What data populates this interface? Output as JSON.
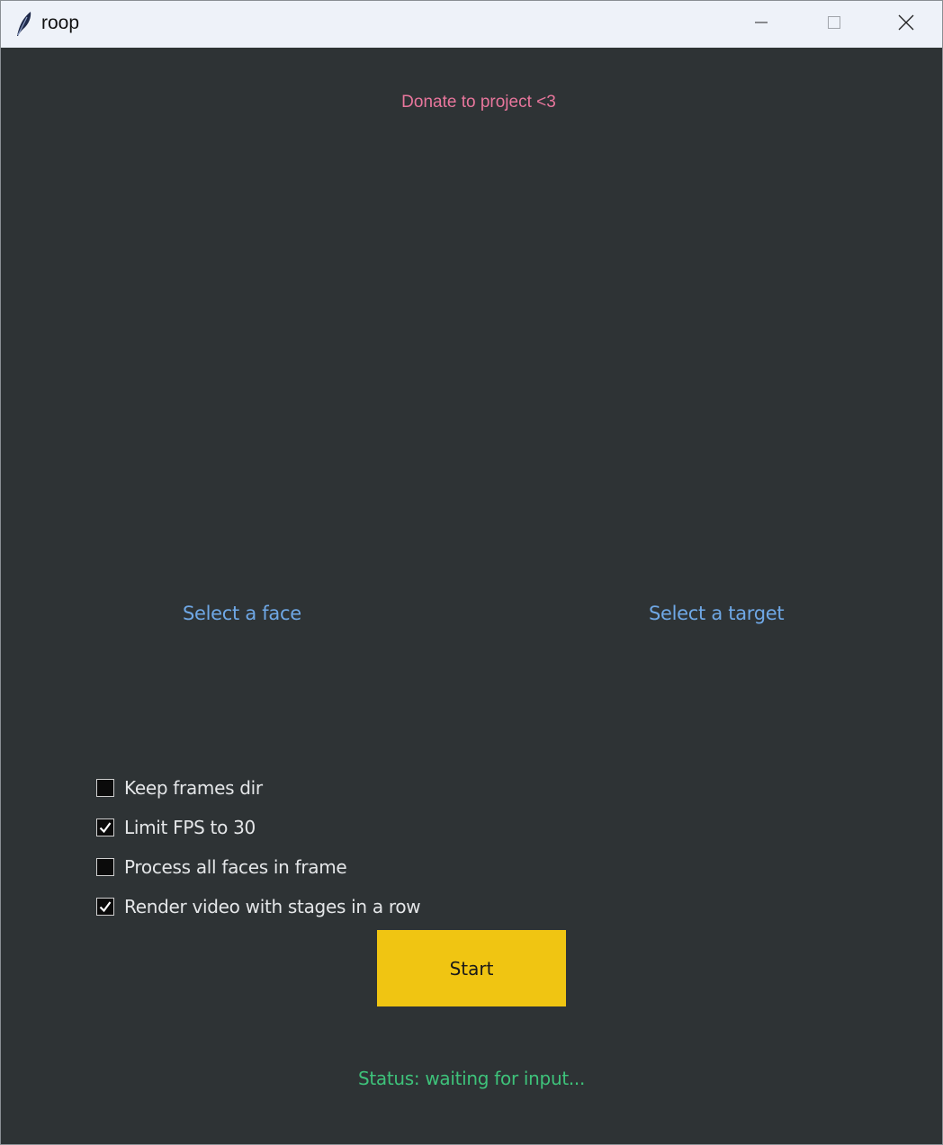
{
  "window": {
    "title": "roop",
    "icon": "feather-icon",
    "controls": [
      "minimize-icon",
      "maximize-icon",
      "close-icon"
    ]
  },
  "donate": {
    "label": "Donate to project <3",
    "color": "#e8769c"
  },
  "source": {
    "label": "Select a face"
  },
  "target": {
    "label": "Select a target"
  },
  "options": [
    {
      "label": "Keep frames dir",
      "checked": false
    },
    {
      "label": "Limit FPS to 30",
      "checked": true
    },
    {
      "label": "Process all faces in frame",
      "checked": false
    },
    {
      "label": "Render video with stages in a row",
      "checked": true
    }
  ],
  "start": {
    "label": "Start",
    "color": "#f0c512"
  },
  "status": {
    "text": "Status: waiting for input...",
    "color": "#3ec27a"
  },
  "colors": {
    "background": "#2e3335",
    "link": "#6fa8e6"
  }
}
